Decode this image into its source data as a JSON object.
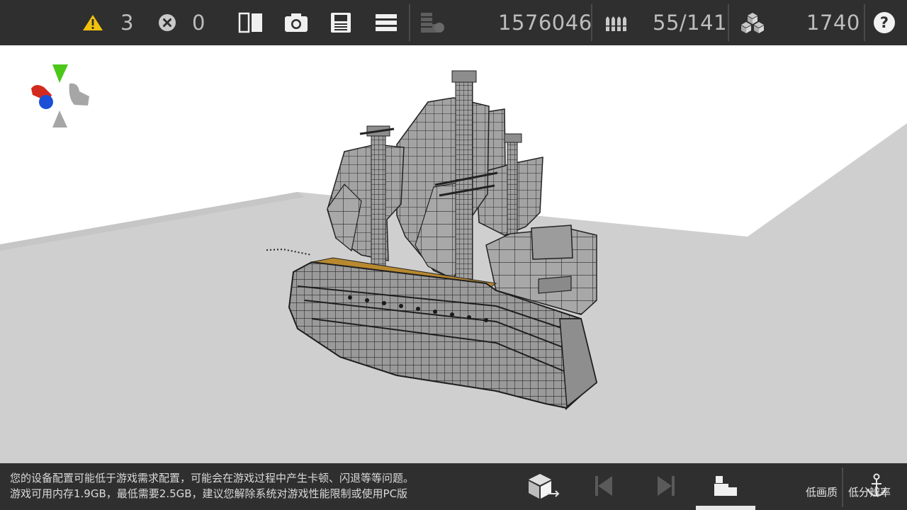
{
  "colors": {
    "bar_bg": "#2f2f2f",
    "warning": "#f2c20f",
    "axis_x": "#d32a1f",
    "axis_y": "#4cc81b",
    "axis_z": "#1b4fd6",
    "deck": "#b8892f",
    "sky": "#ffffff",
    "floor": "#cfcfcf"
  },
  "topbar": {
    "warning_icon": "warning-triangle-icon",
    "warning_count": "3",
    "error_icon": "error-circle-x-icon",
    "error_count": "0",
    "tools": [
      "split-view-icon",
      "camera-icon",
      "save-icon",
      "menu-icon"
    ],
    "weight_icon": "weight-stack-icon",
    "weight_value": "1576046",
    "ammo_icon": "ammo-icon",
    "ammo_value": "55/141",
    "blocks_icon": "blocks-cluster-icon",
    "blocks_value": "1740",
    "help_label": "?"
  },
  "bottombar": {
    "warning_line1": "您的设备配置可能低于游戏需求配置，可能会在游戏过程中产生卡顿、闪退等等问题。",
    "warning_line2": "游戏可用内存1.9GB，最低需要2.5GB，建议您解除系统对游戏性能限制或使用PC版",
    "buttons": [
      "block-cube-icon",
      "undo-icon",
      "redo-icon",
      "build-mode-icon",
      "anchor-icon"
    ],
    "low_quality_label": "低画质",
    "low_resolution_label": "低分辨率"
  }
}
